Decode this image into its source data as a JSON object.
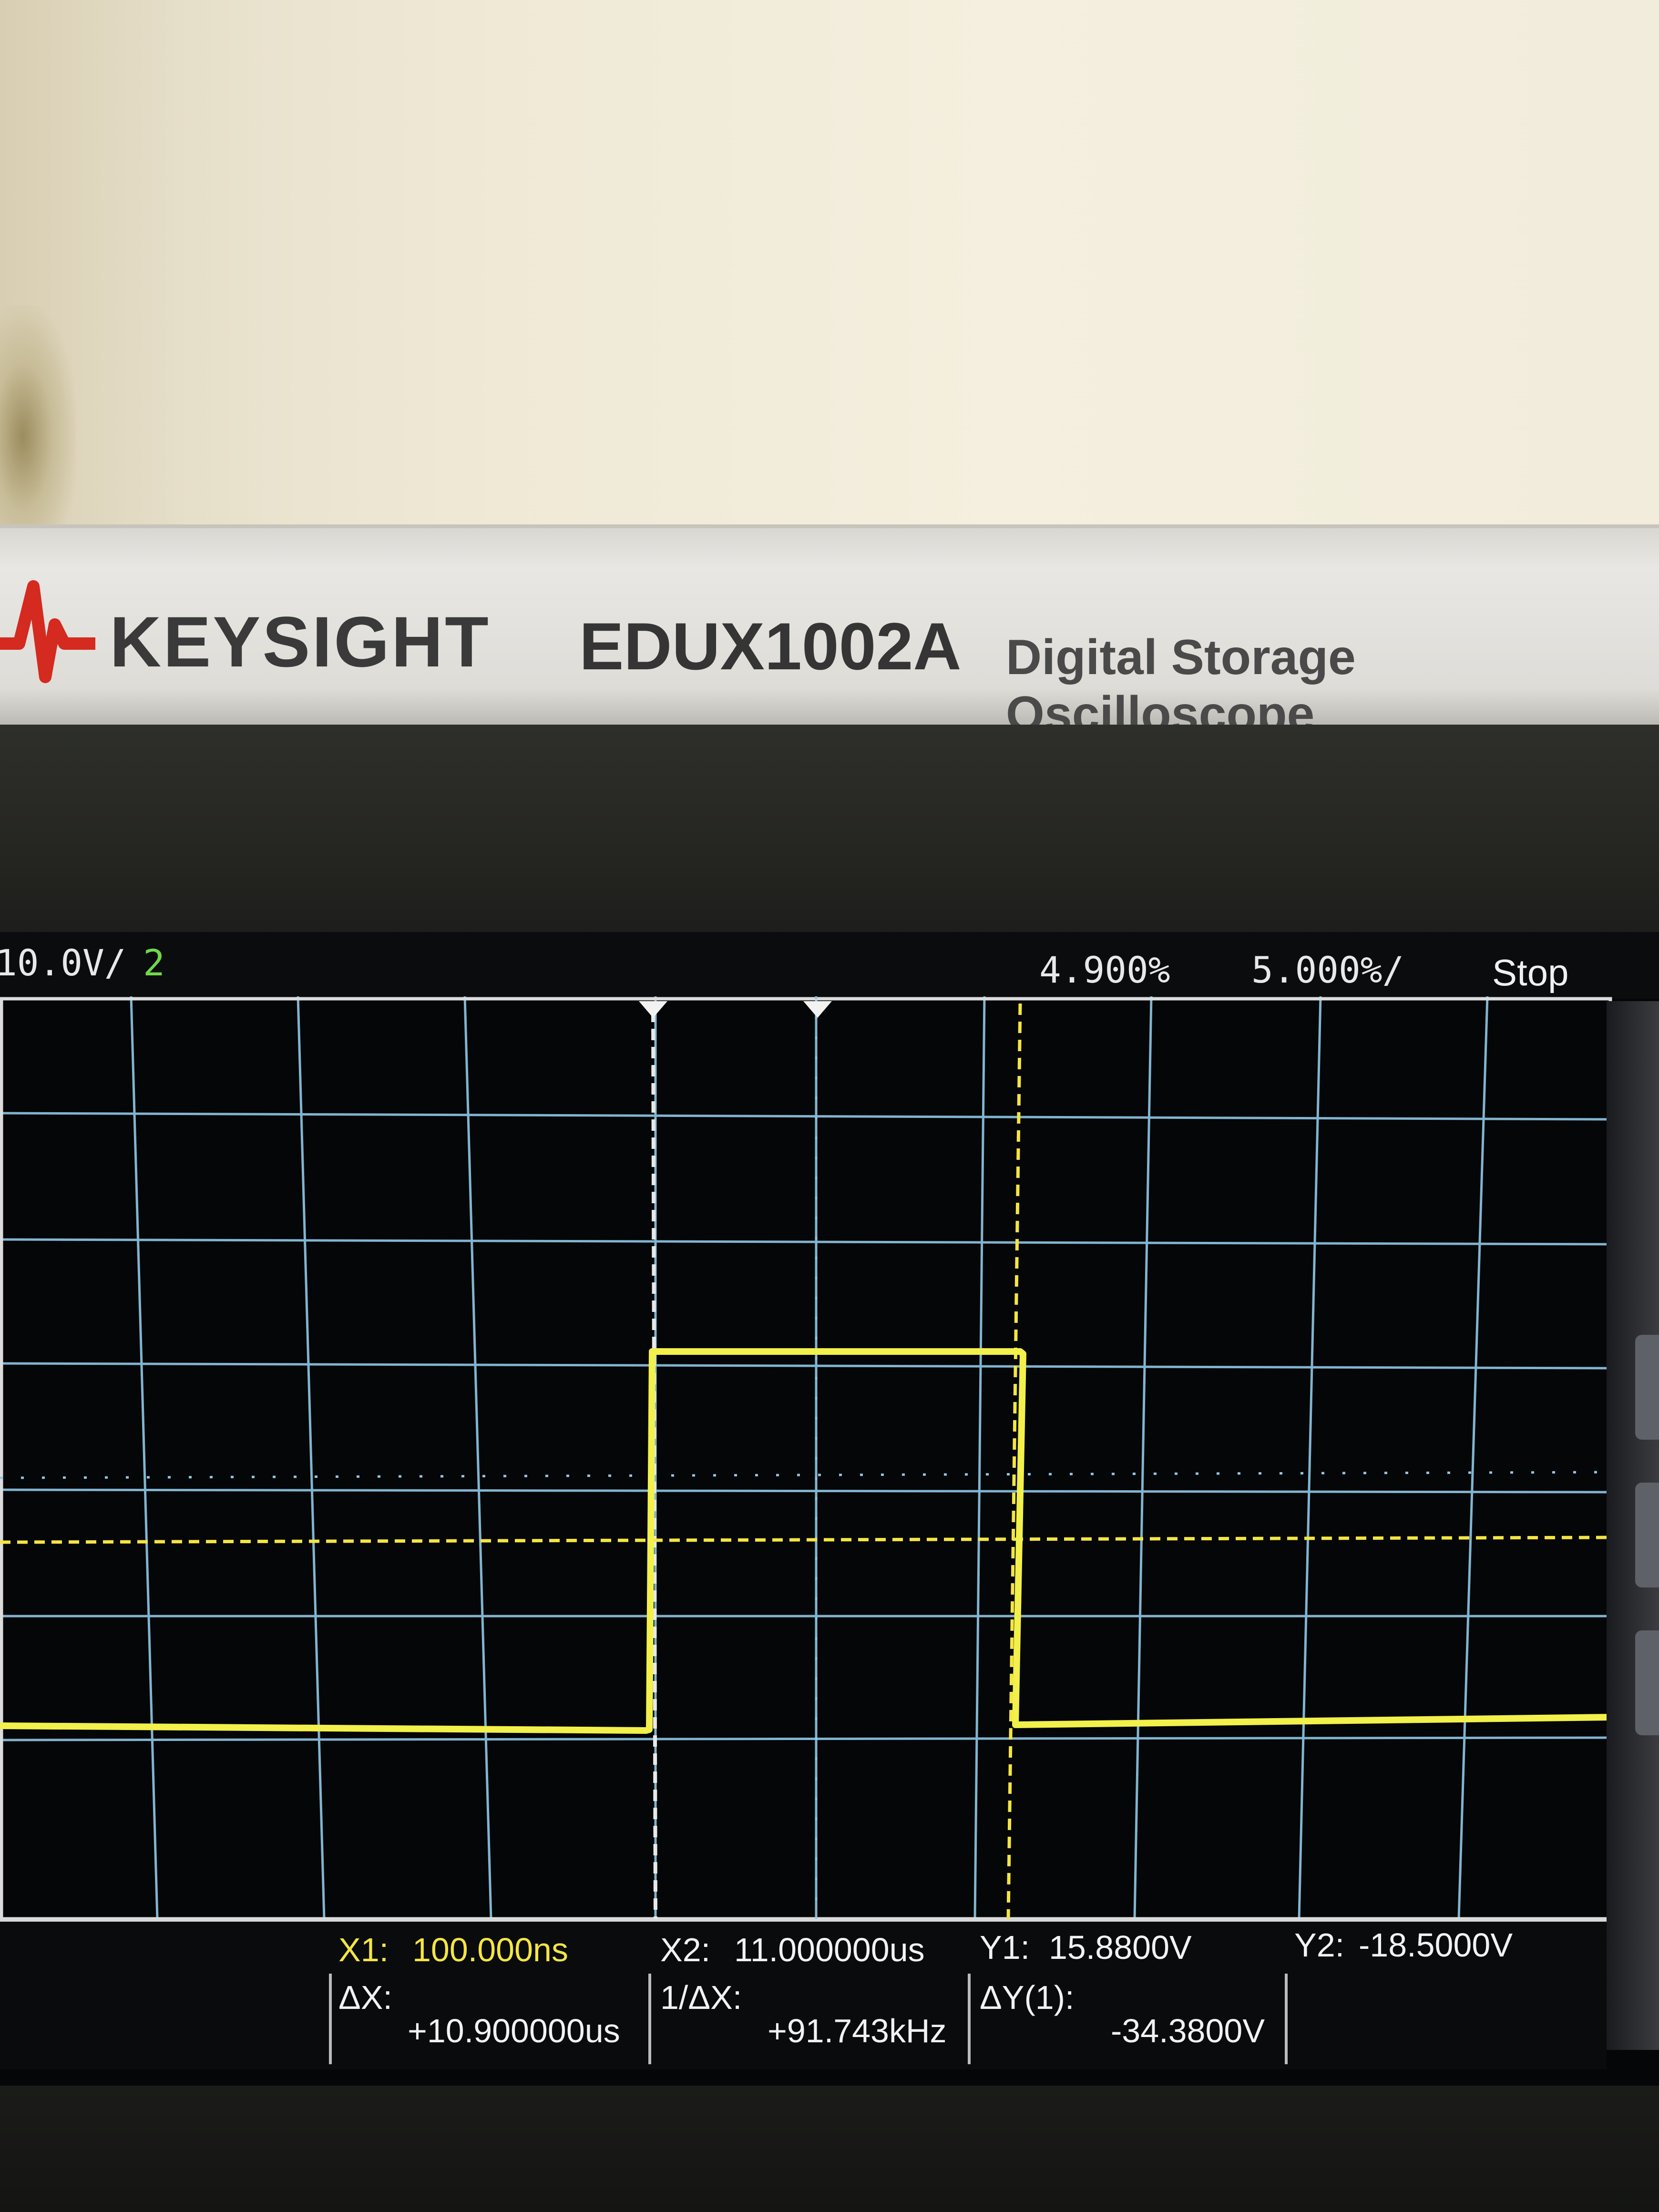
{
  "device": {
    "brand": "KEYSIGHT",
    "model": "EDUX1002A",
    "description": "Digital Storage Oscilloscope"
  },
  "status_bar": {
    "channel_scale": "10.0V/",
    "channel_number": "2",
    "time_delay": "4.900%",
    "time_scale": "5.000%/",
    "run_state": "Stop"
  },
  "measurements": {
    "x1_label": "X1:",
    "x1_value": "100.000ns",
    "x2_label": "X2:",
    "x2_value": "11.000000us",
    "y1_label": "Y1:",
    "y1_value": "15.8800V",
    "y2_label": "Y2:",
    "y2_value": "-18.5000V",
    "dx_label": "ΔX:",
    "dx_value": "+10.900000us",
    "inv_dx_label": "1/ΔX:",
    "inv_dx_value": "+91.743kHz",
    "dy_label": "ΔY(1):",
    "dy_value": "-34.3800V"
  },
  "colors": {
    "trace": "#f2f04a",
    "grid": "#8fc8e6",
    "cursor": "#f4e542",
    "screen": "#050608"
  }
}
